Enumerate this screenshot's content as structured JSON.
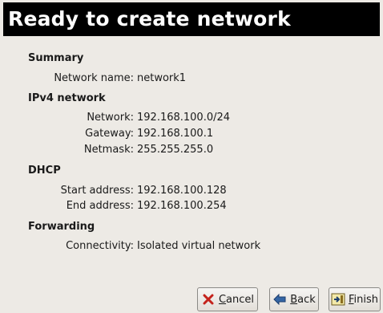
{
  "header": {
    "title": "Ready to create network"
  },
  "sections": {
    "summary": {
      "heading": "Summary",
      "network_name_label": "Network name:",
      "network_name_value": "network1"
    },
    "ipv4": {
      "heading": "IPv4 network",
      "network_label": "Network:",
      "network_value": "192.168.100.0/24",
      "gateway_label": "Gateway:",
      "gateway_value": "192.168.100.1",
      "netmask_label": "Netmask:",
      "netmask_value": "255.255.255.0"
    },
    "dhcp": {
      "heading": "DHCP",
      "start_label": "Start address:",
      "start_value": "192.168.100.128",
      "end_label": "End address:",
      "end_value": "192.168.100.254"
    },
    "forwarding": {
      "heading": "Forwarding",
      "connectivity_label": "Connectivity:",
      "connectivity_value": "Isolated virtual network"
    }
  },
  "buttons": {
    "cancel": {
      "mnemonic": "C",
      "rest": "ancel",
      "icon": "cancel-icon"
    },
    "back": {
      "mnemonic": "B",
      "rest": "ack",
      "icon": "back-arrow-icon"
    },
    "finish": {
      "mnemonic": "F",
      "rest": "inish",
      "icon": "finish-icon"
    }
  },
  "colors": {
    "background": "#edeae5",
    "banner": "#000000",
    "banner_text": "#ffffff",
    "cancel_red": "#c4221b",
    "back_blue": "#3465a4"
  }
}
